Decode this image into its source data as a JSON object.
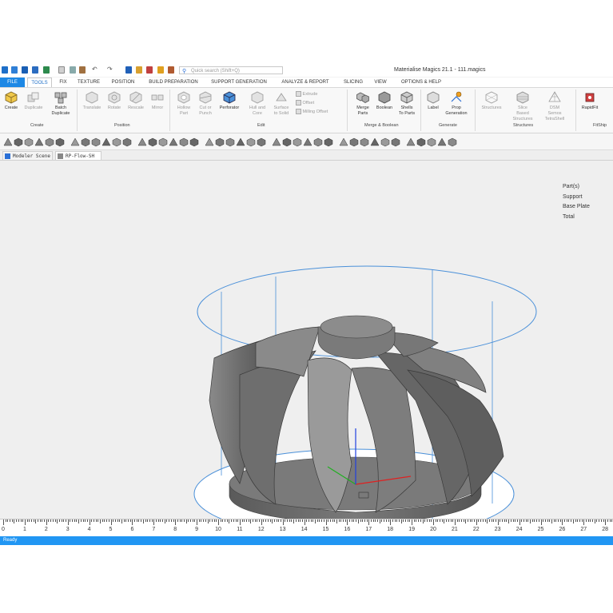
{
  "window": {
    "title": "Materialise Magics 21.1 - 111.magics",
    "search_placeholder": "Quick search (Shift+Q)"
  },
  "menu": {
    "items": [
      "FILE",
      "TOOLS",
      "FIX",
      "TEXTURE",
      "POSITION",
      "BUILD PREPARATION",
      "SUPPORT GENERATION",
      "ANALYZE & REPORT",
      "SLICING",
      "VIEW",
      "OPTIONS & HELP"
    ],
    "active": "TOOLS"
  },
  "ribbon": {
    "create": {
      "create": "Create",
      "duplicate": "Duplicate",
      "batch": "Batch",
      "batch2": "Duplicate",
      "group": "Create"
    },
    "position": {
      "translate": "Translate",
      "rotate": "Rotate",
      "rescale": "Rescale",
      "mirror": "Mirror",
      "group": "Position"
    },
    "edit": {
      "hollow": "Hollow",
      "hollow2": "Part",
      "cut": "Cut or",
      "cut2": "Punch",
      "perforator": "Perforator",
      "hull": "Hull and",
      "hull2": "Core",
      "surface": "Surface",
      "surface2": "to Solid",
      "extrude": "Extrude",
      "offset": "Offset",
      "milling": "Milling Offset",
      "group": "Edit"
    },
    "merge": {
      "merge": "Merge",
      "merge2": "Parts",
      "boolean": "Boolean",
      "shells": "Shells",
      "shells2": "To Parts",
      "group": "Merge & Boolean"
    },
    "generate": {
      "label": "Label",
      "prop": "Prop",
      "prop2": "Generation",
      "group": "Generate"
    },
    "structures": {
      "structures": "Structures",
      "slice": "Slice Based",
      "slice2": "Structures",
      "dsm": "DSM Semos",
      "dsm2": "TetraShell",
      "group": "Structures"
    },
    "fabship": {
      "rapidfit": "RapidFit",
      "group": "FitShip"
    }
  },
  "tabs": [
    "Modeler Scene",
    "RP-Flow-SH"
  ],
  "legend": [
    "Part(s)",
    "Support",
    "Base Plate",
    "Total"
  ],
  "ruler": {
    "labels": [
      "0",
      "1",
      "2",
      "3",
      "4",
      "5",
      "6",
      "7",
      "8",
      "9",
      "10",
      "11",
      "12",
      "13",
      "14",
      "15",
      "16",
      "17",
      "18",
      "19",
      "20",
      "21",
      "22",
      "23",
      "24",
      "25",
      "26",
      "27",
      "28"
    ]
  },
  "status": "Ready",
  "colors": {
    "accent": "#1e88e5",
    "status_bar": "#2196f3",
    "bounding_box": "#4a90d9",
    "part": "#6b6b6b"
  }
}
